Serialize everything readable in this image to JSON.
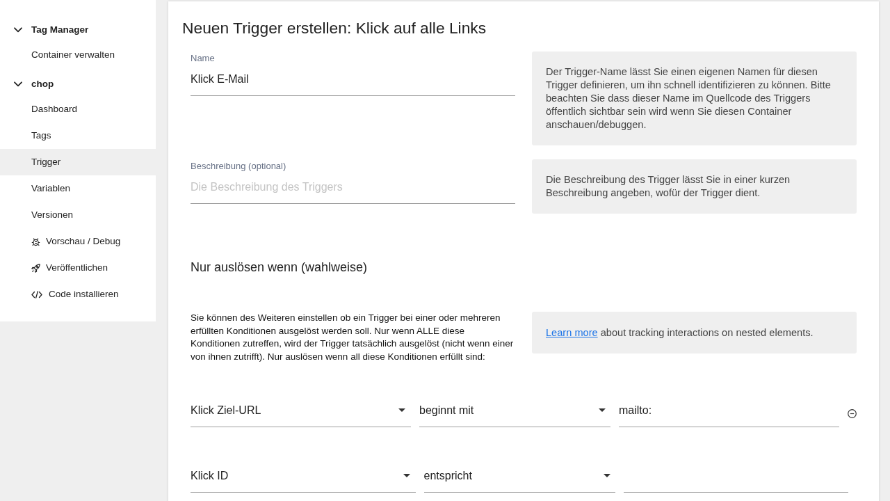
{
  "sidebar": {
    "groups": [
      {
        "title": "Tag Manager",
        "expanded": true,
        "items": [
          {
            "label": "Container verwalten",
            "kind": "page",
            "selected": false
          }
        ]
      },
      {
        "title": "chop",
        "expanded": true,
        "items": [
          {
            "label": "Dashboard",
            "kind": "page",
            "selected": false
          },
          {
            "label": "Tags",
            "kind": "page",
            "selected": false
          },
          {
            "label": "Trigger",
            "kind": "page",
            "selected": true
          },
          {
            "label": "Variablen",
            "kind": "page",
            "selected": false
          },
          {
            "label": "Versionen",
            "kind": "page",
            "selected": false
          },
          {
            "label": "Vorschau / Debug",
            "kind": "preview",
            "selected": false
          },
          {
            "label": "Veröffentlichen",
            "kind": "publish",
            "selected": false
          },
          {
            "label": "Code installieren",
            "kind": "install",
            "selected": false
          }
        ]
      }
    ]
  },
  "editor": {
    "title": "Neuen Trigger erstellen: Klick auf alle Links",
    "fields": [
      {
        "label": "Name",
        "value": "Klick E-Mail",
        "help": "Der Trigger-Name lässt Sie einen eigenen Namen für diesen Trigger definieren, um ihn schnell identifizieren zu können. Bitte beachten Sie dass dieser Name im Quellcode des Triggers öffentlich sichtbar sein wird wenn Sie diesen Container anschauen/debuggen."
      },
      {
        "label": "Beschreibung (optional)",
        "placeholder": "Die Beschreibung des Triggers",
        "help": "Die Beschreibung des Trigger lässt Sie in einer kurzen Beschreibung angeben, wofür der Trigger dient."
      }
    ],
    "conditions_heading": "Nur auslösen wenn (wahlweise)",
    "conditions_description": "Sie können des Weiteren einstellen ob ein Trigger bei einer oder mehreren erfüllten Konditionen ausgelöst werden soll. Nur wenn ALLE diese Konditionen zutreffen, wird der Trigger tatsächlich ausgelöst (nicht wenn einer von ihnen zutrifft). Nur auslösen wenn all diese Konditionen erfüllt sind:",
    "conditions_help": {
      "link": "Learn more",
      "text": "about tracking interactions on nested elements."
    },
    "conditions": [
      {
        "variable": "Klick Ziel-URL",
        "operator": "beginnt mit",
        "value": "mailto:",
        "removable": true
      },
      {
        "variable": "Klick ID",
        "operator": "entspricht",
        "removable": false
      }
    ]
  }
}
